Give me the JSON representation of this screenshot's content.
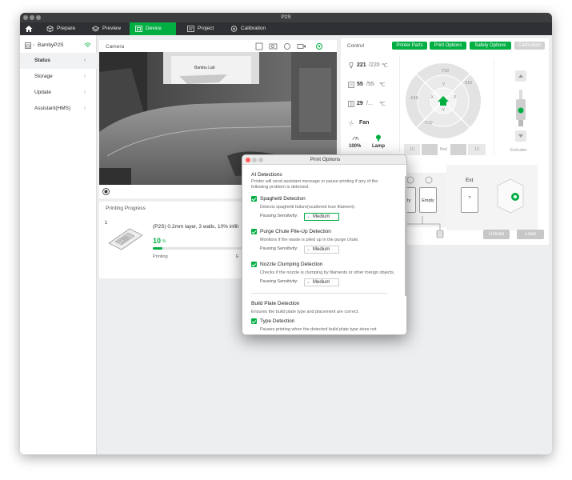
{
  "window": {
    "title": "P2S"
  },
  "nav": {
    "tabs": [
      {
        "label": "Prepare",
        "icon": "cube-icon"
      },
      {
        "label": "Preview",
        "icon": "layers-icon"
      },
      {
        "label": "Device",
        "icon": "device-icon"
      },
      {
        "label": "Project",
        "icon": "project-icon"
      },
      {
        "label": "Calibration",
        "icon": "target-icon"
      }
    ],
    "active": "Device"
  },
  "sidebar": {
    "device_name": "BambyP2S",
    "items": [
      {
        "label": "Status"
      },
      {
        "label": "Storage"
      },
      {
        "label": "Update"
      },
      {
        "label": "Assistant(HMS)"
      }
    ],
    "active": "Status"
  },
  "camera": {
    "title": "Camera",
    "overlay_text": "Bambu Lab"
  },
  "control": {
    "title": "Control",
    "buttons": {
      "printer_parts": "Printer Parts",
      "print_options": "Print Options",
      "safety_options": "Safety Options",
      "calibration": "Calibration"
    },
    "nozzle": {
      "current": "221",
      "target": "/220",
      "unit": "℃"
    },
    "bed": {
      "current": "55",
      "target": "/55",
      "unit": "℃"
    },
    "chamber": {
      "current": "29",
      "target": "/...",
      "unit": "℃"
    },
    "fan": {
      "label": "Fan"
    },
    "speed": {
      "value": "100%"
    },
    "lamp": {
      "label": "Lamp"
    },
    "jog_labels": {
      "x": "X",
      "y": "Y",
      "minus_y": "-Y",
      "minus_x": "-X",
      "x10": "X10",
      "y10": "Y10",
      "minus_x10": "-X10",
      "minus_y10": "-Y10"
    },
    "bed_row": {
      "left": "10",
      "label": "Bed",
      "right": "10"
    },
    "extruder_label": "Extruder",
    "ams": {
      "slot1": "Empty",
      "slot2": "Empty",
      "slot1_partial": "pty",
      "ext_title": "Ext",
      "ext_slot": "?",
      "unload": "Unload",
      "load": "Load"
    }
  },
  "progress": {
    "title": "Printing Progress",
    "plate_index": "1",
    "job": "(P2S) 0.2mm layer, 3 walls, 10% infill",
    "percent": "10",
    "percent_unit": "%",
    "status": "Printing",
    "status_right": "E",
    "fraction": 0.1
  },
  "dialog": {
    "title": "Print Options",
    "ai": {
      "title": "AI Detections",
      "desc": "Printer will send assistant message or pause printing if any of the following problem is detected."
    },
    "options": [
      {
        "title": "Spaghetti Detection",
        "desc": "Detects spaghetti failure(scattered lose filament).",
        "sens_label": "Pausing Sensitivity:",
        "sens_value": "Medium"
      },
      {
        "title": "Purge Chute Pile-Up Detection",
        "desc": "Monitors if the waste is piled up in the purge chute.",
        "sens_label": "Pausing Sensitivity:",
        "sens_value": "Medium"
      },
      {
        "title": "Nozzle Clumping Detection",
        "desc": "Checks if the nozzle is clumping by filaments or other foreign objects.",
        "sens_label": "Pausing Sensitivity:",
        "sens_value": "Medium"
      }
    ],
    "build_plate": {
      "title": "Build Plate Detection",
      "desc": "Ensures the build plate type and placement are correct.",
      "type_title": "Type Detection",
      "type_desc": "Pauses printing when the detected build plate type does not"
    }
  },
  "colors": {
    "accent": "#00ae42",
    "nav_bg": "#2e3033",
    "titlebar_bg": "#3c3d3f"
  }
}
